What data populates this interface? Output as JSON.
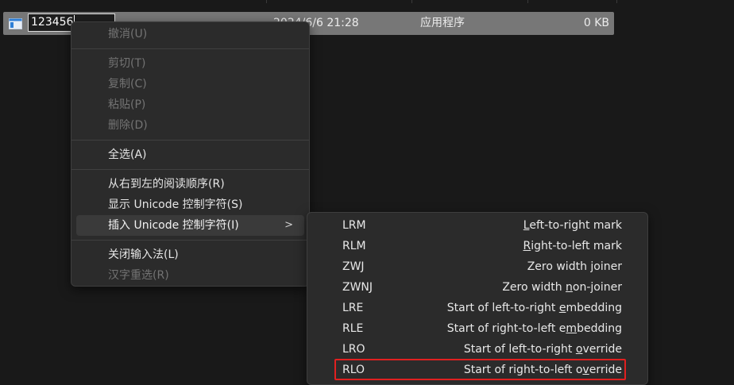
{
  "file": {
    "name_value": "123456",
    "modified": "2024/6/6 21:28",
    "type": "应用程序",
    "size": "0 KB"
  },
  "context_menu": {
    "undo": "撤消(U)",
    "cut": "剪切(T)",
    "copy": "复制(C)",
    "paste": "粘贴(P)",
    "delete": "删除(D)",
    "select_all": "全选(A)",
    "rtl_reading": "从右到左的阅读顺序(R)",
    "show_unicode": "显示 Unicode 控制字符(S)",
    "insert_unicode": "插入 Unicode 控制字符(I)",
    "close_ime": "关闭输入法(L)",
    "reconvert": "汉字重选(R)"
  },
  "unicode_menu": {
    "items": [
      {
        "code": "LRM",
        "desc_pre": "",
        "desc_u": "L",
        "desc_post": "eft-to-right mark"
      },
      {
        "code": "RLM",
        "desc_pre": "",
        "desc_u": "R",
        "desc_post": "ight-to-left mark"
      },
      {
        "code": "ZWJ",
        "desc_pre": "Zero width ",
        "desc_u": "j",
        "desc_post": "oiner"
      },
      {
        "code": "ZWNJ",
        "desc_pre": "Zero width ",
        "desc_u": "n",
        "desc_post": "on-joiner"
      },
      {
        "code": "LRE",
        "desc_pre": "Start of left-to-right ",
        "desc_u": "e",
        "desc_post": "mbedding"
      },
      {
        "code": "RLE",
        "desc_pre": "Start of right-to-left e",
        "desc_u": "m",
        "desc_post": "bedding"
      },
      {
        "code": "LRO",
        "desc_pre": "Start of left-to-right ",
        "desc_u": "o",
        "desc_post": "verride"
      },
      {
        "code": "RLO",
        "desc_pre": "Start of right-to-left o",
        "desc_u": "v",
        "desc_post": "erride"
      }
    ]
  },
  "colors": {
    "highlight_border": "#e02020",
    "selected_row": "#777777",
    "menu_bg": "#2b2b2b"
  }
}
